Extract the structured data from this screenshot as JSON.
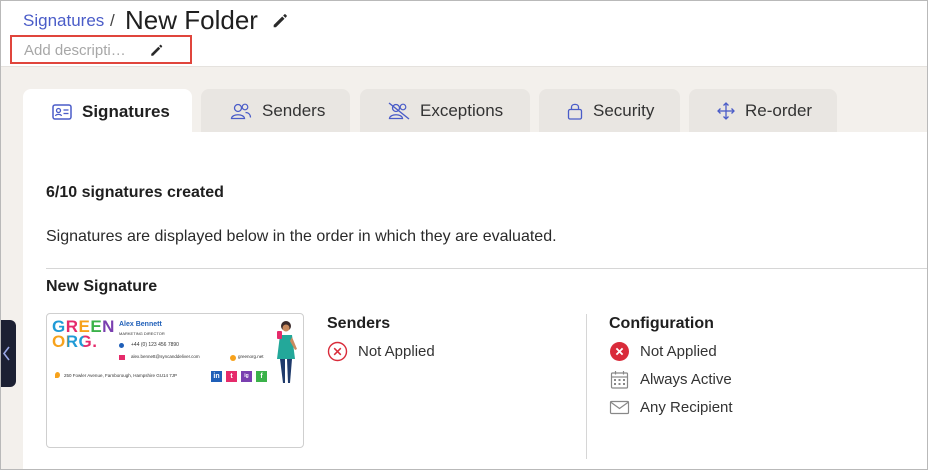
{
  "header": {
    "breadcrumb": "Signatures",
    "separator": "/",
    "title": "New Folder",
    "description_placeholder": "Add descripti…"
  },
  "tabs": [
    {
      "label": "Signatures",
      "icon": "id-card-icon",
      "active": true
    },
    {
      "label": "Senders",
      "icon": "users-icon",
      "active": false
    },
    {
      "label": "Exceptions",
      "icon": "users-slash-icon",
      "active": false
    },
    {
      "label": "Security",
      "icon": "lock-icon",
      "active": false
    },
    {
      "label": "Re-order",
      "icon": "move-arrows-icon",
      "active": false
    }
  ],
  "main": {
    "count_text": "6/10 signatures created",
    "info_text": "Signatures are displayed below in the order in which they are evaluated."
  },
  "signature": {
    "name": "New Signature",
    "preview": {
      "logo_line1": "GREEN",
      "logo_line2": "ORG.",
      "person_name": "Alex Bennett",
      "person_title": "MARKETING DIRECTOR",
      "phone": "+44 (0) 123 456 7890",
      "email": "alex.bennett@syncanddeliver.com",
      "website": "greenorg.net",
      "address": "250 Fowler Avenue, Farnborough, Hampshire GU14 7JP",
      "social": [
        "in",
        "t",
        "ig",
        "f"
      ]
    },
    "senders": {
      "title": "Senders",
      "status": "Not Applied"
    },
    "configuration": {
      "title": "Configuration",
      "items": [
        {
          "label": "Not Applied",
          "icon": "x-circle-filled-icon"
        },
        {
          "label": "Always Active",
          "icon": "calendar-icon"
        },
        {
          "label": "Any Recipient",
          "icon": "envelope-icon"
        }
      ]
    }
  },
  "colors": {
    "accent": "#4a5cc8",
    "highlight_border": "#e0453c",
    "error": "#d92b3a",
    "sidebar": "#1c2033"
  }
}
